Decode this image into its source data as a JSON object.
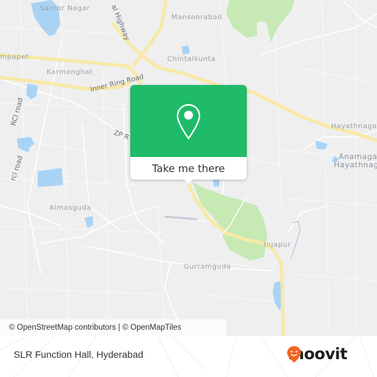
{
  "map": {
    "labels": {
      "saroor_nagar": "Saroor Nagar",
      "mansoorabad": "Mansoorabad",
      "champapet": "mpapet",
      "chintalkunta": "Chintalkunta",
      "karmanghat": "Karmanghat",
      "hayathnagar": "Hayathnagar",
      "anamagal_hayathnagar_1": "Anamagal",
      "anamagal_hayathnagar_2": "Hayathnagar",
      "almasguda": "Almasguda",
      "injapur": "Injapur",
      "gurramguda": "Gurramguda"
    },
    "road_labels": {
      "inner_ring_road": "Inner Ring Road",
      "highway": "al Highway",
      "rci_road_upper": "RCI road",
      "rci_road_lower": "rci road",
      "zp_road": "ZP R"
    },
    "colors": {
      "background": "#efeff0",
      "water": "#a9d3f5",
      "park": "#c7e9b4",
      "major_road": "#f8e9a8",
      "minor_road": "#ffffff"
    }
  },
  "popup": {
    "button_label": "Take me there",
    "icon": "map-pin-icon",
    "color": "#1fbb69"
  },
  "attribution": {
    "text": "© OpenStreetMap contributors | © OpenMapTiles"
  },
  "footer": {
    "place_name": "SLR Function Hall, Hyderabad",
    "brand_name": "moovit",
    "brand_color": "#f26522"
  }
}
